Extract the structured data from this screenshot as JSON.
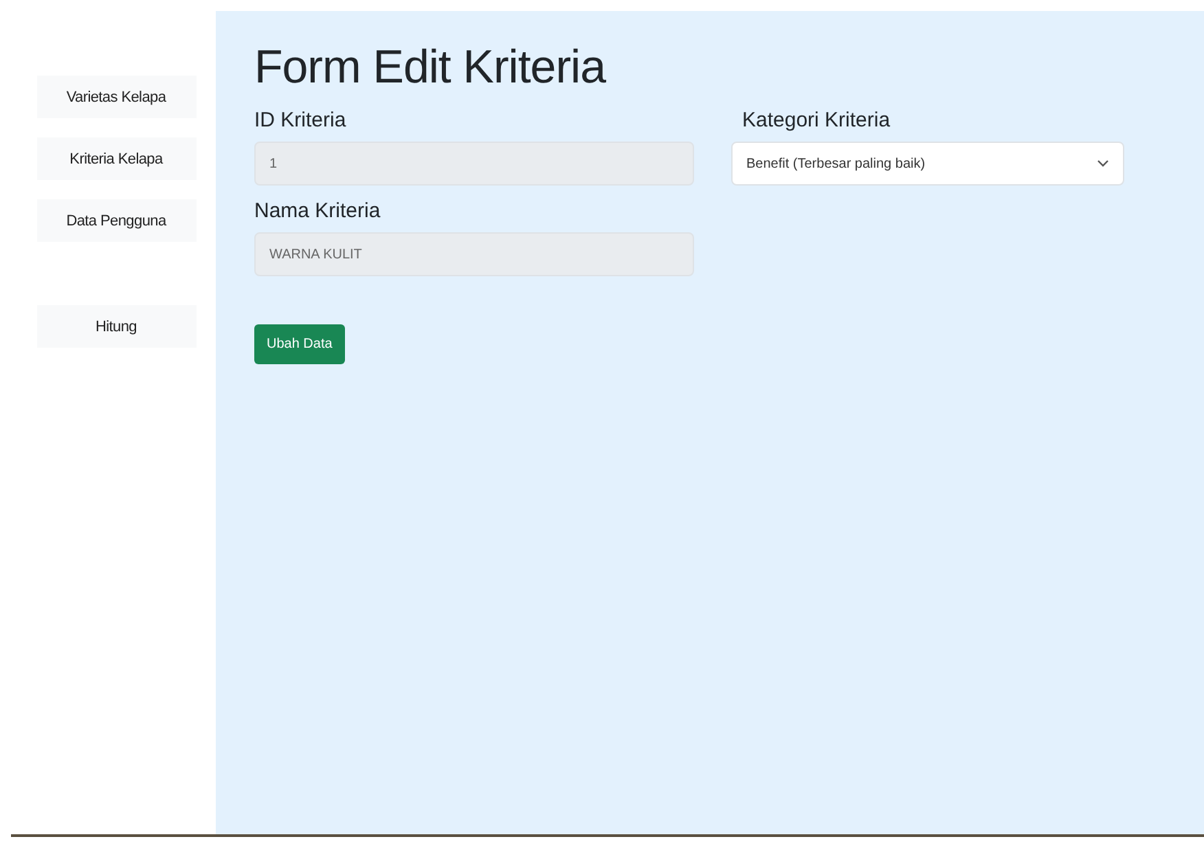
{
  "sidebar": {
    "items": [
      {
        "label": "Varietas Kelapa",
        "selected": false
      },
      {
        "label": "Kriteria Kelapa",
        "selected": false
      },
      {
        "label": "Data Pengguna",
        "selected": false
      },
      {
        "label": "Hitung",
        "selected": false
      }
    ]
  },
  "form": {
    "title": "Form Edit Kriteria",
    "fields": [
      {
        "kind": "input",
        "label": "ID Kriteria",
        "value": "1",
        "disabled": true
      },
      {
        "kind": "input",
        "label": "Nama Kriteria",
        "value": "WARNA KULIT",
        "disabled": true
      },
      {
        "kind": "select",
        "label": "Kategori Kriteria",
        "value": "Benefit (Terbesar paling baik)",
        "disabled": false
      }
    ],
    "submit": "Ubah Data"
  }
}
